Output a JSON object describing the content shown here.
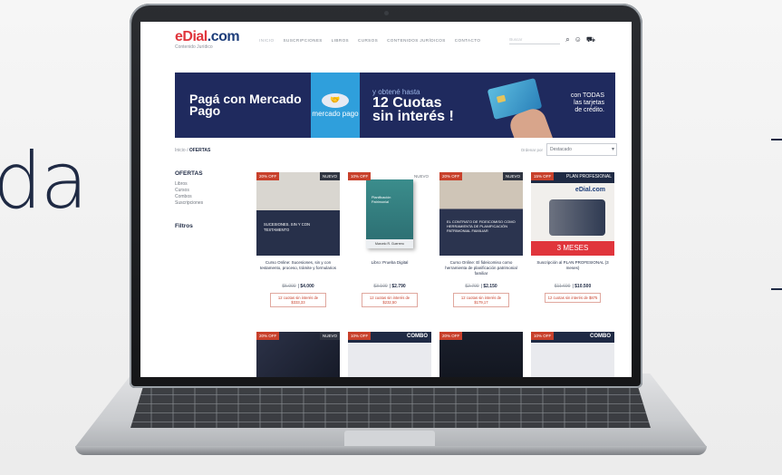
{
  "background_text": "da",
  "site": {
    "logo": {
      "part1": "eDial",
      "part2": ".com",
      "tagline": "Contenido Jurídico"
    },
    "menu": [
      "INICIO",
      "SUSCRIPCIONES",
      "LIBROS",
      "CURSOS",
      "CONTENIDOS JURÍDICOS",
      "CONTACTO"
    ],
    "search_placeholder": "Buscar",
    "icons": [
      "search-icon",
      "user-icon",
      "cart-icon"
    ]
  },
  "banner": {
    "left": "Pagá con Mercado Pago",
    "mp_label": "mercado pago",
    "top_line": "y obtené hasta",
    "big_line1": "12 Cuotas",
    "big_line2": "sin interés !",
    "right_line1": "con TODAS",
    "right_line2": "las tarjetas",
    "right_line3": "de crédito."
  },
  "breadcrumb": {
    "home": "Inicio",
    "sep": " / ",
    "current": "OFERTAS"
  },
  "sort": {
    "label": "Ordenar por",
    "value": "Destacado"
  },
  "sidebar": {
    "title": "OFERTAS",
    "links": [
      "Libros",
      "Cursos",
      "Combos",
      "Suscripciones"
    ],
    "filters_title": "Filtros"
  },
  "products": [
    {
      "ribbon": "20% OFF",
      "tag": "NUEVO",
      "cover_text": "SUCESIONES. SIN Y CON TESTAMENTO",
      "name": "Curso Online: Sucesiones, sin y con testamento, proceso, trámite y formularios",
      "old_price": "$5.000",
      "price": "$4.000",
      "quota": "12 cuotas sin interés de $333,33"
    },
    {
      "ribbon": "10% OFF",
      "tag": "NUEVO",
      "cover_text": "Planificación Patrimonial",
      "author": "Marcelo R. Guerrero",
      "name": "Libro: Prueba Digital",
      "old_price": "$3.100",
      "price": "$2.790",
      "quota": "12 cuotas sin interés de $232,50"
    },
    {
      "ribbon": "20% OFF",
      "tag": "NUEVO",
      "cover_text": "EL CONTRATO DE FIDEICOMISO COMO HERRAMIENTA DE PLANIFICACIÓN PATRIMONIAL FAMILIAR",
      "name": "Curso Online: El fideicomiso como herramienta de planificación patrimonial familiar",
      "old_price": "$2.700",
      "price": "$2.150",
      "quota": "12 cuotas sin interés de $179,17"
    },
    {
      "ribbon": "15% OFF",
      "tag": "PLAN PROFESIONAL",
      "cover_text": "eDial.com",
      "banner_text": "3 MESES",
      "name": "Suscripción al PLAN PROFESIONAL (3 meses)",
      "old_price": "$11.600",
      "price": "$10.500",
      "quota": "12 cuotas sin interés de $875"
    },
    {
      "ribbon": "20% OFF",
      "tag": "NUEVO"
    },
    {
      "ribbon": "10% OFF",
      "tag": "COMBO"
    },
    {
      "ribbon": "20% OFF",
      "tag": ""
    },
    {
      "ribbon": "10% OFF",
      "tag": "COMBO"
    }
  ]
}
